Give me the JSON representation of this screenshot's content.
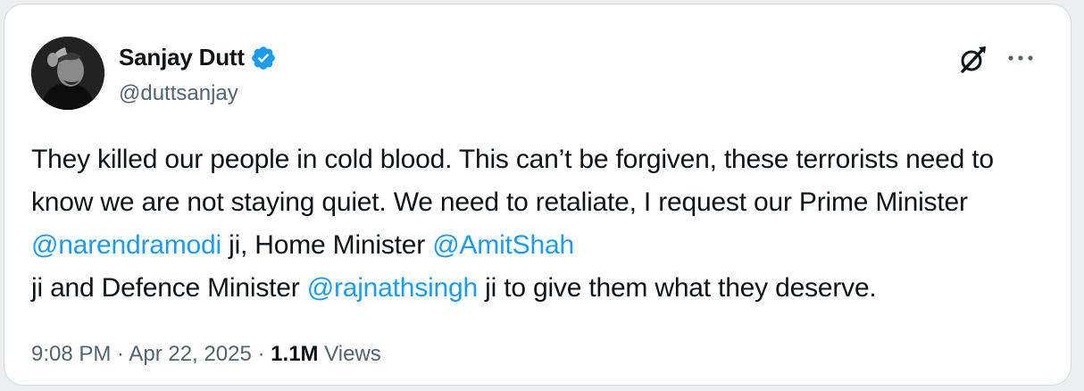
{
  "author": {
    "display_name": "Sanjay Dutt",
    "handle": "@duttsanjay",
    "verified": true,
    "avatar_icon": "profile-photo"
  },
  "actions": {
    "grok_icon": "grok-icon",
    "more_icon": "more-horizontal-icon"
  },
  "tweet": {
    "seg1": "They killed our people in cold blood. This can’t be forgiven, these terrorists need to know we are not staying quiet. We need to retaliate, I request our Prime Minister ",
    "mention1": "@narendramodi",
    "seg2": " ji, Home Minister ",
    "mention2": "@AmitShah",
    "seg3": " ji and Defence Minister ",
    "mention3": "@rajnathsingh",
    "seg4": " ji to give them what they deserve."
  },
  "meta": {
    "time": "9:08 PM",
    "separator1": " · ",
    "date": "Apr 22, 2025",
    "separator2": " · ",
    "views_count": "1.1M",
    "views_label": " Views"
  },
  "colors": {
    "accent": "#1d9bf0",
    "text": "#0f1419",
    "secondary": "#536471",
    "verified": "#1d9bf0"
  }
}
